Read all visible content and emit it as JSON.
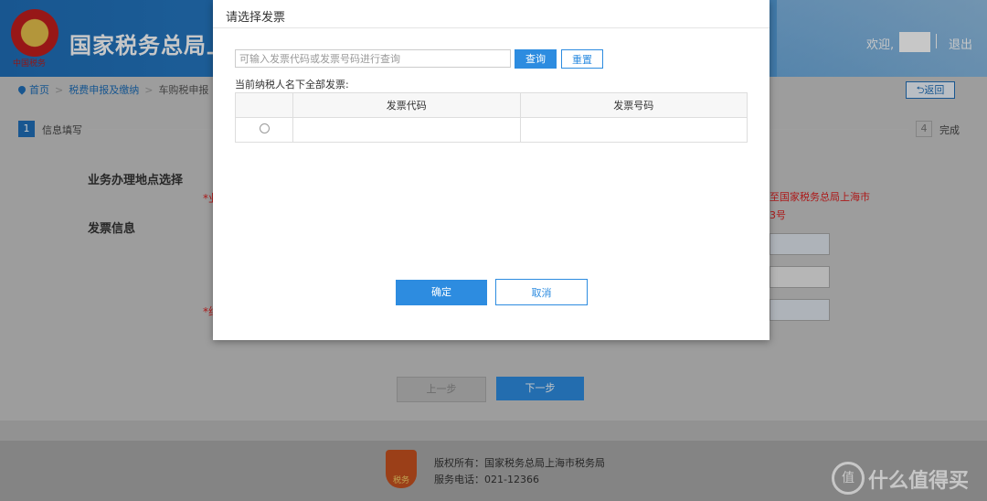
{
  "header": {
    "emblem_caption": "中国税务",
    "site_title": "国家税务总局上",
    "welcome": "欢迎,",
    "logout": "退出"
  },
  "breadcrumb": {
    "home": "首页",
    "level2": "税费申报及缴纳",
    "level3": "车购税申报",
    "back": "返回"
  },
  "steps": {
    "step1_num": "1",
    "step1_label": "信息填写",
    "step4_num": "4",
    "step4_label": "完成"
  },
  "form": {
    "section_location": "业务办理地点选择",
    "section_invoice": "发票信息",
    "req1": "*业",
    "req2": "*纳",
    "red_note_line1": "至国家税务总局上海市",
    "red_note_line2": "3号"
  },
  "nav": {
    "prev": "上一步",
    "next": "下一步"
  },
  "footer": {
    "copyright": "版权所有：国家税务总局上海市税务局",
    "phone": "服务电话：021-12366",
    "shield_text": "税务",
    "watermark": "什么值得买",
    "watermark_glyph": "值"
  },
  "modal": {
    "title": "请选择发票",
    "search_placeholder": "可输入发票代码或发票号码进行查询",
    "query": "查询",
    "reset": "重置",
    "caption": "当前纳税人名下全部发票:",
    "columns": [
      "",
      "发票代码",
      "发票号码"
    ],
    "rows": [
      {
        "code": "",
        "number": ""
      }
    ],
    "ok": "确定",
    "cancel": "取消"
  }
}
